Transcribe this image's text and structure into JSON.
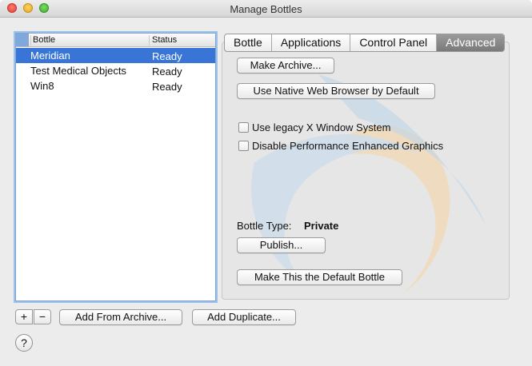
{
  "window": {
    "title": "Manage Bottles"
  },
  "list": {
    "columns": {
      "bottle": "Bottle",
      "status": "Status"
    },
    "rows": [
      {
        "name": "Meridian",
        "status": "Ready",
        "selected": true
      },
      {
        "name": "Test Medical Objects",
        "status": "Ready",
        "selected": false
      },
      {
        "name": "Win8",
        "status": "Ready",
        "selected": false
      }
    ]
  },
  "tabs": [
    {
      "label": "Bottle",
      "active": false
    },
    {
      "label": "Applications",
      "active": false
    },
    {
      "label": "Control Panel",
      "active": false
    },
    {
      "label": "Advanced",
      "active": true
    }
  ],
  "advanced": {
    "make_archive": "Make Archive...",
    "use_native_browser": "Use Native Web Browser by Default",
    "legacy_x_window": {
      "label": "Use legacy X Window System",
      "checked": false
    },
    "disable_performance": {
      "label": "Disable Performance Enhanced Graphics",
      "checked": false
    },
    "bottle_type_label": "Bottle Type:",
    "bottle_type_value": "Private",
    "publish": "Publish...",
    "make_default": "Make This the Default Bottle"
  },
  "footer": {
    "add": "+",
    "remove": "−",
    "add_from_archive": "Add From Archive...",
    "add_duplicate": "Add Duplicate...",
    "help": "?"
  },
  "colors": {
    "selection": "#3875d7",
    "active_tab": "#858585",
    "focus_ring": "#9cc0ea"
  }
}
